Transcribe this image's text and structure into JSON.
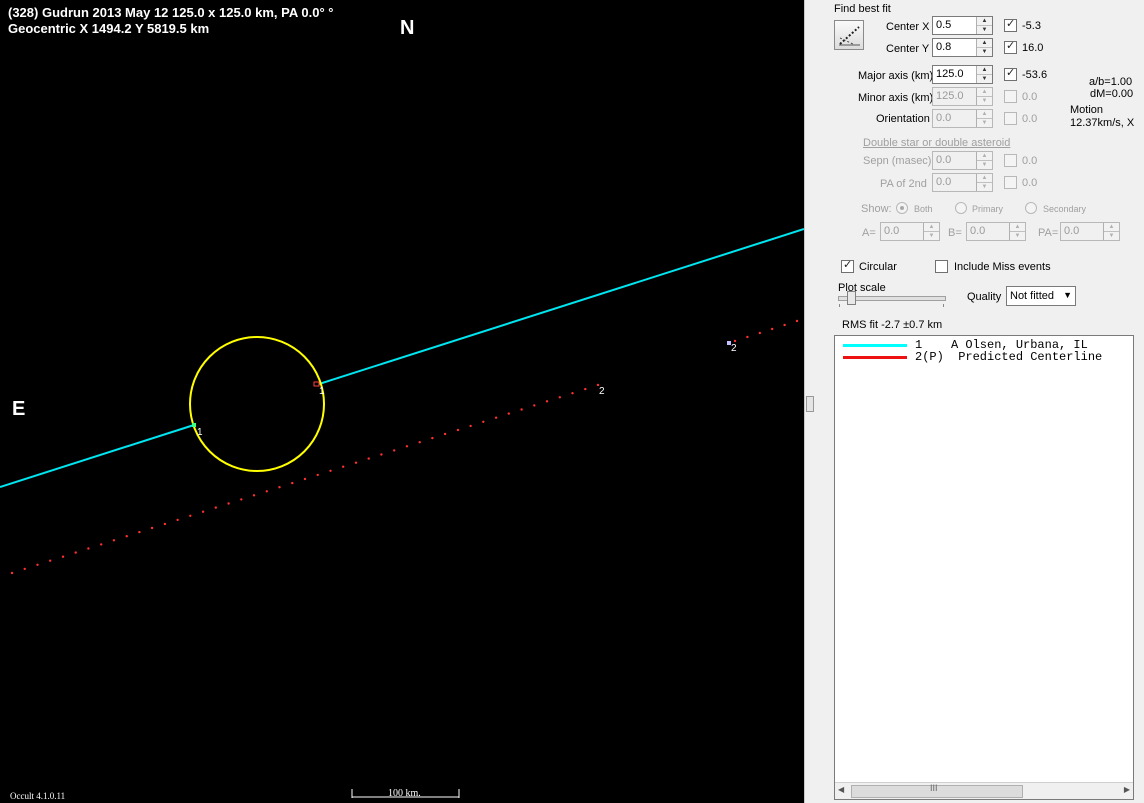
{
  "plot": {
    "header_line1": "(328) Gudrun  2013 May 12   125.0 x 125.0 km, PA 0.0° °",
    "header_line2": "Geocentric  X  1494.2  Y 5819.5 km",
    "north_label": "N",
    "east_label": "E",
    "version": "Occult 4.1.0.11",
    "scale_label": "100 km.",
    "marker_obs1_a": "1",
    "marker_obs1_b": "1",
    "marker_pred_a": "2",
    "marker_pred_b": "2",
    "colors": {
      "background": "#000000",
      "ellipse": "#ffff00",
      "observer_chord": "#00e5f0",
      "predicted_track": "#ff3030"
    }
  },
  "panel": {
    "find_best_fit_label": "Find best fit",
    "center_x": {
      "label": "Center X",
      "value": "0.5",
      "fitted": true,
      "fit_value": "-5.3"
    },
    "center_y": {
      "label": "Center Y",
      "value": "0.8",
      "fitted": true,
      "fit_value": "16.0"
    },
    "major_axis": {
      "label": "Major axis (km)",
      "value": "125.0",
      "fitted": true,
      "fit_value": "-53.6"
    },
    "minor_axis": {
      "label": "Minor axis (km)",
      "value": "125.0",
      "fitted": false,
      "fit_value": "0.0"
    },
    "orientation": {
      "label": "Orientation",
      "value": "0.0",
      "fitted": false,
      "fit_value": "0.0"
    },
    "ratio": "a/b=1.00",
    "dm": "dM=0.00",
    "motion_label": "Motion",
    "motion_value": "12.37km/s, X",
    "double_star_heading": "Double star  or  double asteroid",
    "sepn": {
      "label": "Sepn (masec)",
      "value": "0.0",
      "fit_value": "0.0"
    },
    "pa2": {
      "label": "PA of 2nd",
      "value": "0.0",
      "fit_value": "0.0"
    },
    "show_label": "Show:",
    "show_options": [
      "Both",
      "Primary",
      "Secondary"
    ],
    "a_label": "A=",
    "a_value": "0.0",
    "b_label": "B=",
    "b_value": "0.0",
    "pa_label": "PA=",
    "pa_value": "0.0",
    "circular_label": "Circular",
    "circular_checked": true,
    "include_miss_label": "Include Miss events",
    "include_miss_checked": false,
    "plot_scale_label": "Plot scale",
    "plot_scale_value": 0.08,
    "quality_label": "Quality",
    "quality_value": "Not fitted",
    "rms_label": "RMS fit -2.7 ±0.7 km",
    "legend": [
      {
        "text": "1    A Olsen, Urbana, IL",
        "color": "#00ffff"
      },
      {
        "text": "2(P)  Predicted Centerline",
        "color": "#ee1111"
      }
    ],
    "scroll_grip": "III"
  }
}
